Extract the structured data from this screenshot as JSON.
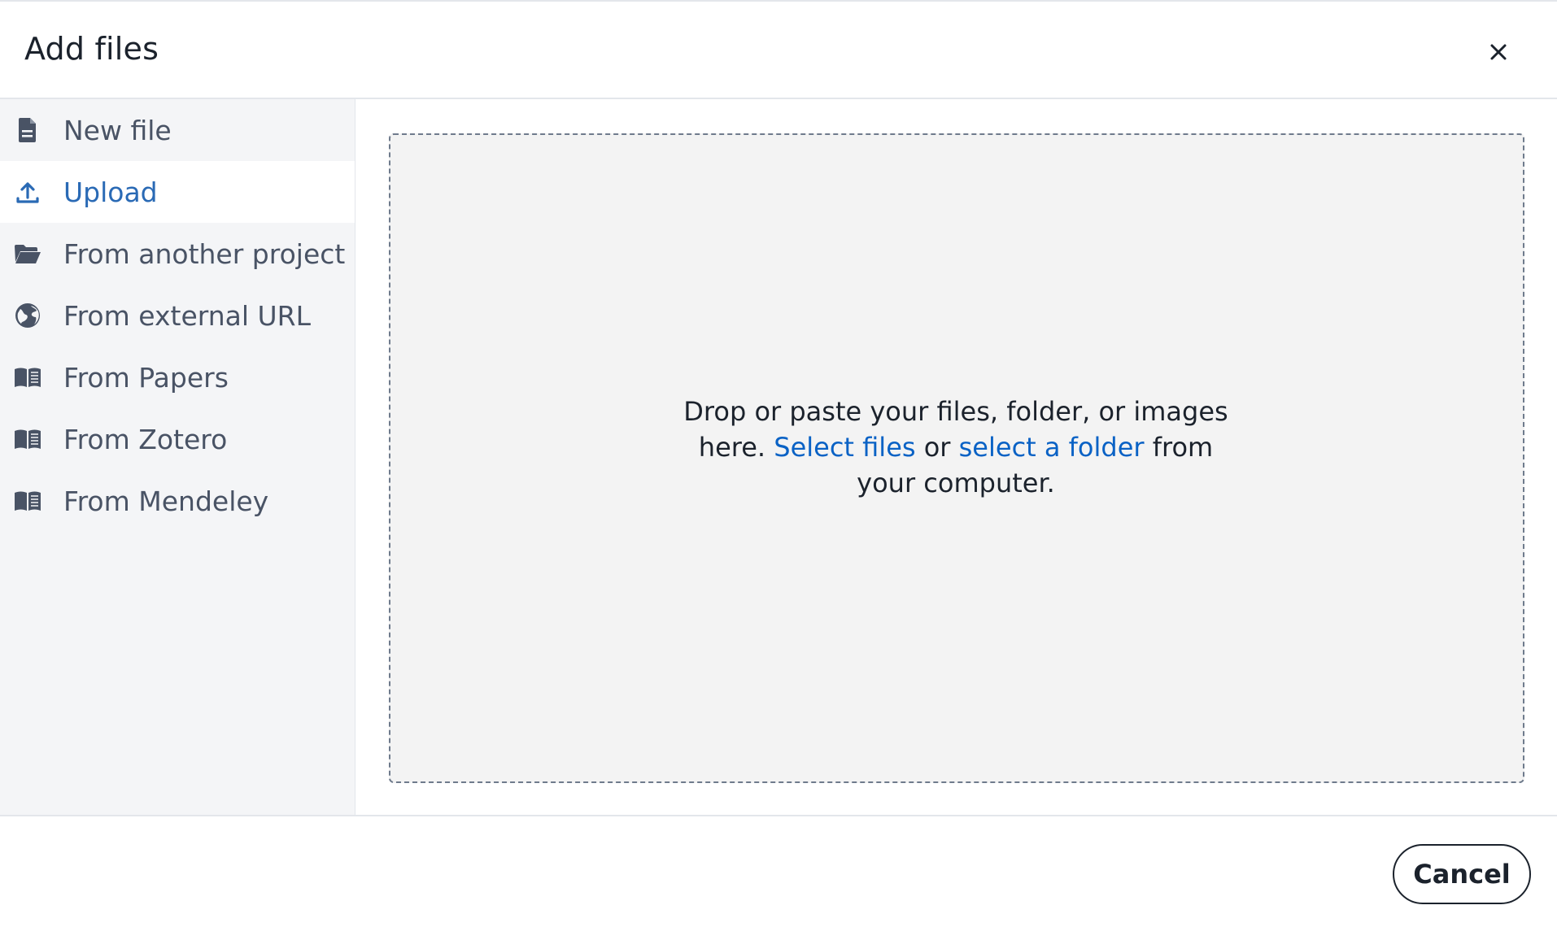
{
  "dialog": {
    "title": "Add files",
    "close_icon": "close-icon"
  },
  "sidebar": {
    "items": [
      {
        "label": "New file",
        "icon": "document-icon",
        "active": false
      },
      {
        "label": "Upload",
        "icon": "upload-icon",
        "active": true
      },
      {
        "label": "From another project",
        "icon": "folder-open-icon",
        "active": false
      },
      {
        "label": "From external URL",
        "icon": "globe-icon",
        "active": false
      },
      {
        "label": "From Papers",
        "icon": "book-open-icon",
        "active": false
      },
      {
        "label": "From Zotero",
        "icon": "book-open-icon",
        "active": false
      },
      {
        "label": "From Mendeley",
        "icon": "book-open-icon",
        "active": false
      }
    ]
  },
  "dropzone": {
    "text_before": "Drop or paste your files, folder, or images here.",
    "select_files_link": "Select files",
    "text_middle": "or",
    "select_folder_link": "select a folder",
    "text_after": "from your computer."
  },
  "footer": {
    "cancel_label": "Cancel"
  },
  "colors": {
    "accent": "#2a6ab5",
    "link": "#0a62c5",
    "sidebar_bg": "#f4f5f7",
    "dropzone_bg": "#f3f3f3"
  }
}
